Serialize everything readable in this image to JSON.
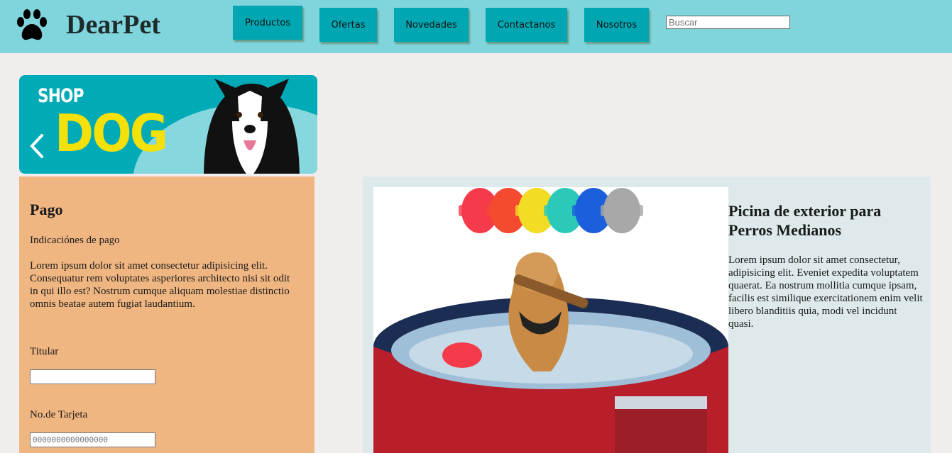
{
  "header": {
    "brand": "DearPet",
    "logo_icon": "paw-icon",
    "nav": [
      {
        "label": "Productos"
      },
      {
        "label": "Ofertas"
      },
      {
        "label": "Novedades"
      },
      {
        "label": "Contactanos"
      },
      {
        "label": "Nosotros"
      }
    ],
    "search": {
      "placeholder": "Buscar",
      "value": ""
    },
    "colors": {
      "header_bg": "#80d4dc",
      "nav_bg": "#00a7b2"
    }
  },
  "banner": {
    "shop_text": "SHOP",
    "dog_text": "DOG",
    "arrow_icon": "chevron-left-icon",
    "colors": {
      "bg": "#00aab6",
      "accent": "#f4e00a"
    }
  },
  "pago": {
    "title": "Pago",
    "subtitle": "Indicaciónes de pago",
    "paragraph": "Lorem ipsum dolor sit amet consectetur adipisicing elit. Consequatur rem voluptates asperiores architecto nisi sit odit in qui illo est? Nostrum cumque aliquam molestiae distinctio omnis beatae autem fugiat laudantium.",
    "titular_label": "Titular",
    "titular_value": "",
    "card_label": "No.de Tarjeta",
    "card_placeholder": "0000000000000000",
    "colors": {
      "bg": "#f0b682"
    }
  },
  "product": {
    "title": "Picina de exterior para Perros Medianos",
    "description": "Lorem ipsum dolor sit amet consectetur, adipisicing elit. Eveniet expedita voluptatem quaerat. Ea nostrum mollitia cumque ipsam, facilis est similique exercitationem enim velit libero blanditiis quia, modi vel incidunt quasi.",
    "brush_colors": [
      "#f53b4a",
      "#f44a30",
      "#f2dc24",
      "#2cc9b9",
      "#1b5fdc",
      "#a8a8a8"
    ]
  }
}
